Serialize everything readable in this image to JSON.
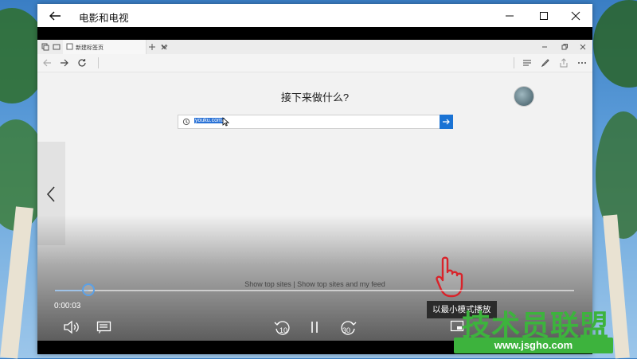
{
  "app": {
    "title": "电影和电视"
  },
  "browser": {
    "tab_title": "新建标签页",
    "question": "接下来做什么?",
    "address_value": "youku.com/",
    "top_sites": "Show top sites | Show top sites and my feed"
  },
  "player": {
    "elapsed": "0:00:03",
    "progress_fraction": 0.065,
    "rewind_label": "10",
    "forward_label": "30",
    "tooltip": "以最小模式播放"
  },
  "watermark": {
    "text": "技术员联盟",
    "url": "www.jsgho.com"
  },
  "colors": {
    "accent": "#1a73d4",
    "watermark": "#3db33d",
    "pointer_hand": "#d8232a"
  }
}
